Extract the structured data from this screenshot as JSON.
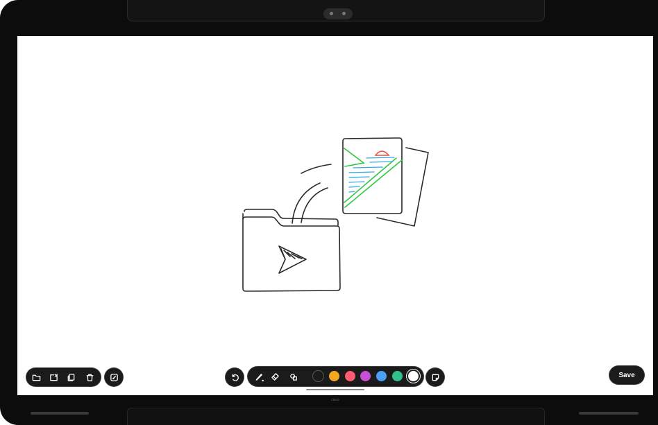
{
  "device": {
    "brand": "cisco"
  },
  "toolbar_left": {
    "icons": [
      "folder-icon",
      "import-icon",
      "duplicate-icon",
      "trash-icon"
    ]
  },
  "toolbar_center": {
    "colors": [
      "#1b1b1b",
      "#f5a623",
      "#ff5c73",
      "#c94fd6",
      "#4a9ff5",
      "#2fc38b",
      "#ffffff"
    ],
    "selected_color": "#ffffff"
  },
  "save_button": {
    "label": "Save"
  }
}
